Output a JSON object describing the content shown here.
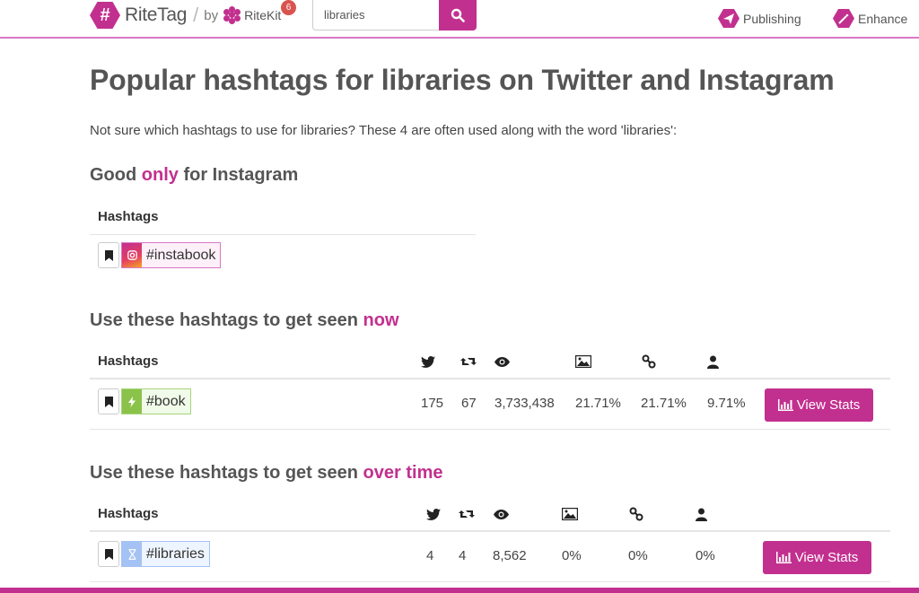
{
  "header": {
    "logo_text": "RiteTag",
    "logo_hash": "#",
    "slash": "/",
    "by": "by",
    "ritekit": "RiteKit",
    "notification_count": "6",
    "search_value": "libraries",
    "nav": [
      {
        "label": "Publishing",
        "icon": "paper-plane-icon"
      },
      {
        "label": "Enhance",
        "icon": "magic-wand-icon"
      }
    ]
  },
  "page": {
    "title": "Popular hashtags for libraries on Twitter and Instagram",
    "intro": "Not sure which hashtags to use for libraries? These 4 are often used along with the word 'libraries':"
  },
  "colors": {
    "accent": "#c2308f",
    "instagram_tag_bg": "#fdf0f8",
    "now_tag_green": "#8bc34a",
    "overtime_tag_blue": "#a4c2f4"
  },
  "sections": {
    "instagram": {
      "title_pre": "Good ",
      "title_accent": "only",
      "title_post": " for Instagram",
      "header": "Hashtags",
      "rows": [
        {
          "tag": "#instabook",
          "type": "instagram"
        }
      ]
    },
    "now": {
      "title_pre": "Use these hashtags to get seen ",
      "title_accent": "now",
      "header": "Hashtags",
      "columns": [
        "tweets-icon",
        "retweets-icon",
        "views-icon",
        "images-icon",
        "links-icon",
        "mentions-icon"
      ],
      "rows": [
        {
          "tag": "#book",
          "tweets": "175",
          "retweets": "67",
          "views": "3,733,438",
          "images": "21.71%",
          "links": "21.71%",
          "mentions": "9.71%",
          "button": "View Stats"
        }
      ]
    },
    "overtime": {
      "title_pre": "Use these hashtags to get seen ",
      "title_accent": "over time",
      "header": "Hashtags",
      "columns": [
        "tweets-icon",
        "retweets-icon",
        "views-icon",
        "images-icon",
        "links-icon",
        "mentions-icon"
      ],
      "rows": [
        {
          "tag": "#libraries",
          "tweets": "4",
          "retweets": "4",
          "views": "8,562",
          "images": "0%",
          "links": "0%",
          "mentions": "0%",
          "button": "View Stats"
        }
      ]
    }
  }
}
